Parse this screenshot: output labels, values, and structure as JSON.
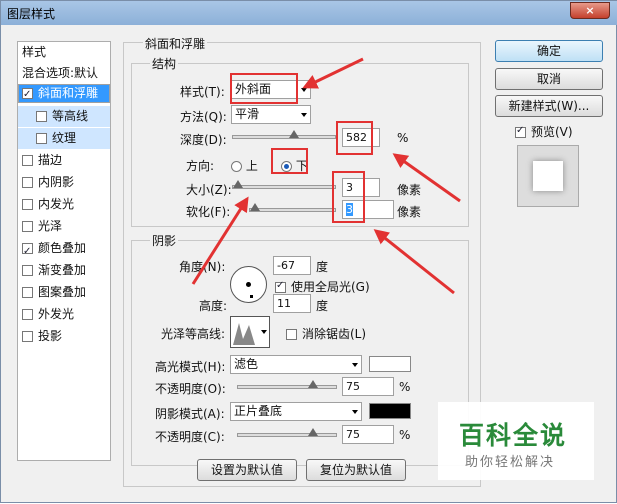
{
  "window": {
    "title": "图层样式",
    "close_label": "×"
  },
  "sidebar": {
    "header": "样式",
    "items": [
      {
        "label": "混合选项:默认",
        "checkbox": false,
        "checked": false
      },
      {
        "label": "斜面和浮雕",
        "checkbox": true,
        "checked": true
      },
      {
        "label": "等高线",
        "checkbox": true,
        "checked": false
      },
      {
        "label": "纹理",
        "checkbox": true,
        "checked": false
      },
      {
        "label": "描边",
        "checkbox": true,
        "checked": false
      },
      {
        "label": "内阴影",
        "checkbox": true,
        "checked": false
      },
      {
        "label": "内发光",
        "checkbox": true,
        "checked": false
      },
      {
        "label": "光泽",
        "checkbox": true,
        "checked": false
      },
      {
        "label": "颜色叠加",
        "checkbox": true,
        "checked": true
      },
      {
        "label": "渐变叠加",
        "checkbox": true,
        "checked": false
      },
      {
        "label": "图案叠加",
        "checkbox": true,
        "checked": false
      },
      {
        "label": "外发光",
        "checkbox": true,
        "checked": false
      },
      {
        "label": "投影",
        "checkbox": true,
        "checked": false
      }
    ]
  },
  "bevel": {
    "title": "斜面和浮雕",
    "structure": {
      "title": "结构",
      "style_label": "样式(T):",
      "style_value": "外斜面",
      "technique_label": "方法(Q):",
      "technique_value": "平滑",
      "depth_label": "深度(D):",
      "depth_value": "582",
      "depth_unit": "%",
      "depth_level": 0.58,
      "direction_label": "方向:",
      "direction_up": "上",
      "direction_down": "下",
      "size_label": "大小(Z):",
      "size_value": "3",
      "size_unit": "像素",
      "soften_label": "软化(F):",
      "soften_value": "3",
      "soften_unit": "像素"
    },
    "shading": {
      "title": "阴影",
      "angle_label": "角度(N):",
      "angle_value": "-67",
      "angle_unit": "度",
      "global_light_label": "使用全局光(G)",
      "altitude_label": "高度:",
      "altitude_value": "11",
      "altitude_unit": "度",
      "gloss_label": "光泽等高线:",
      "antialias_label": "消除锯齿(L)",
      "highlight_mode_label": "高光模式(H):",
      "highlight_mode_value": "滤色",
      "highlight_color": "#ffffff",
      "highlight_opacity_label": "不透明度(O):",
      "highlight_opacity_value": "75",
      "highlight_opacity_unit": "%",
      "shadow_mode_label": "阴影模式(A):",
      "shadow_mode_value": "正片叠底",
      "shadow_color": "#000000",
      "shadow_opacity_label": "不透明度(C):",
      "shadow_opacity_value": "75",
      "shadow_opacity_unit": "%"
    },
    "make_default": "设置为默认值",
    "reset_default": "复位为默认值"
  },
  "buttons": {
    "ok": "确定",
    "cancel": "取消",
    "new_style": "新建样式(W)...",
    "preview_label": "预览(V)"
  },
  "watermark": {
    "line1": "百科全说",
    "line2": "助你轻松解决"
  },
  "colors": {
    "selection": "#3399ff",
    "annotation": "#e23232",
    "watermark_green": "#2a8a3a"
  }
}
